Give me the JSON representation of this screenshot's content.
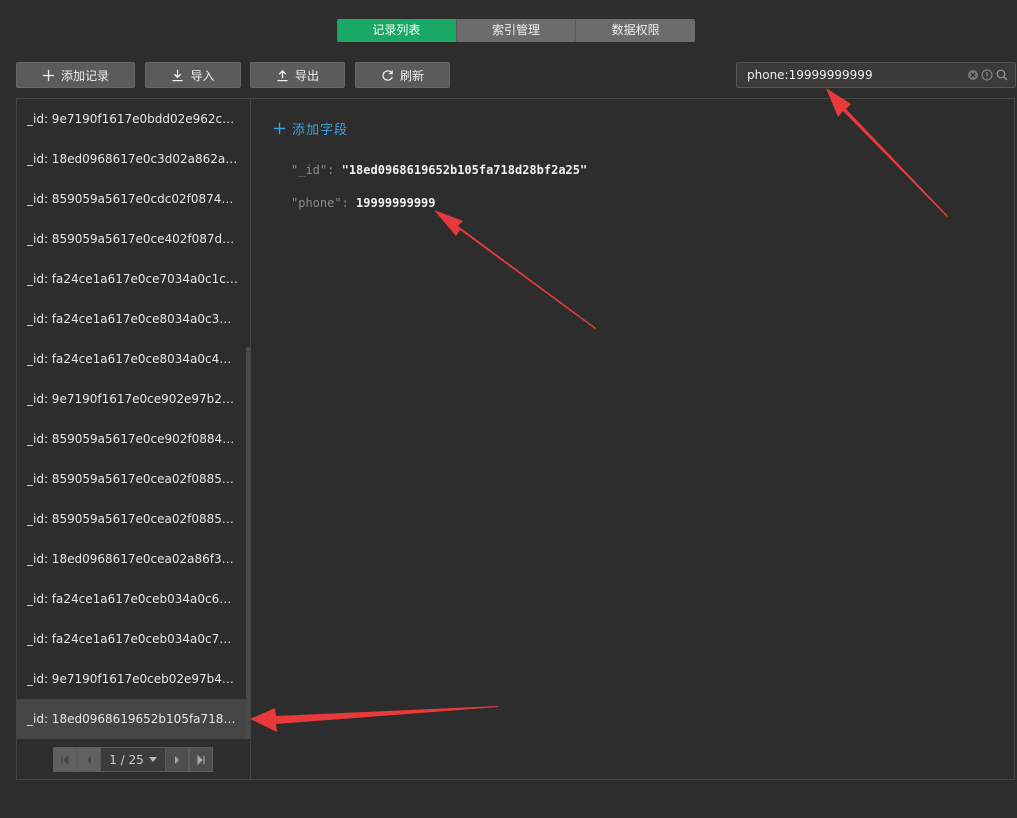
{
  "tabs": [
    {
      "label": "记录列表",
      "active": true
    },
    {
      "label": "索引管理",
      "active": false
    },
    {
      "label": "数据权限",
      "active": false
    }
  ],
  "toolbar": {
    "add_label": "添加记录",
    "import_label": "导入",
    "export_label": "导出",
    "refresh_label": "刷新"
  },
  "search": {
    "value": "phone:19999999999",
    "placeholder": ""
  },
  "records": [
    "_id: 9e7190f1617e0bdd02e962c15...",
    "_id: 18ed0968617e0c3d02a862a10...",
    "_id: 859059a5617e0cdc02f0874951...",
    "_id: 859059a5617e0ce402f087db5...",
    "_id: fa24ce1a617e0ce7034a0c1c5e...",
    "_id: fa24ce1a617e0ce8034a0c3763...",
    "_id: fa24ce1a617e0ce8034a0c4763...",
    "_id: 9e7190f1617e0ce902e97b282...",
    "_id: 859059a5617e0ce902f0884f29...",
    "_id: 859059a5617e0cea02f0885a07...",
    "_id: 859059a5617e0cea02f0885f12...",
    "_id: 18ed0968617e0cea02a86f341c...",
    "_id: fa24ce1a617e0ceb034a0c6d2a...",
    "_id: fa24ce1a617e0ceb034a0c7056...",
    "_id: 9e7190f1617e0ceb02e97b4c3f...",
    "_id: 18ed0968619652b105fa718d2..."
  ],
  "selected_index": 15,
  "pager": {
    "label": "1 / 25"
  },
  "detail": {
    "add_field_label": "添加字段",
    "fields": [
      {
        "key": "\"_id\":",
        "value": "\"18ed0968619652b105fa718d28bf2a25\""
      },
      {
        "key": "\"phone\":",
        "value": "19999999999"
      }
    ]
  },
  "colors": {
    "background": "#2d2d2d",
    "accent_green": "#1aa866",
    "link_blue": "#3aa3e3",
    "annotation_red": "#e83a3a"
  }
}
